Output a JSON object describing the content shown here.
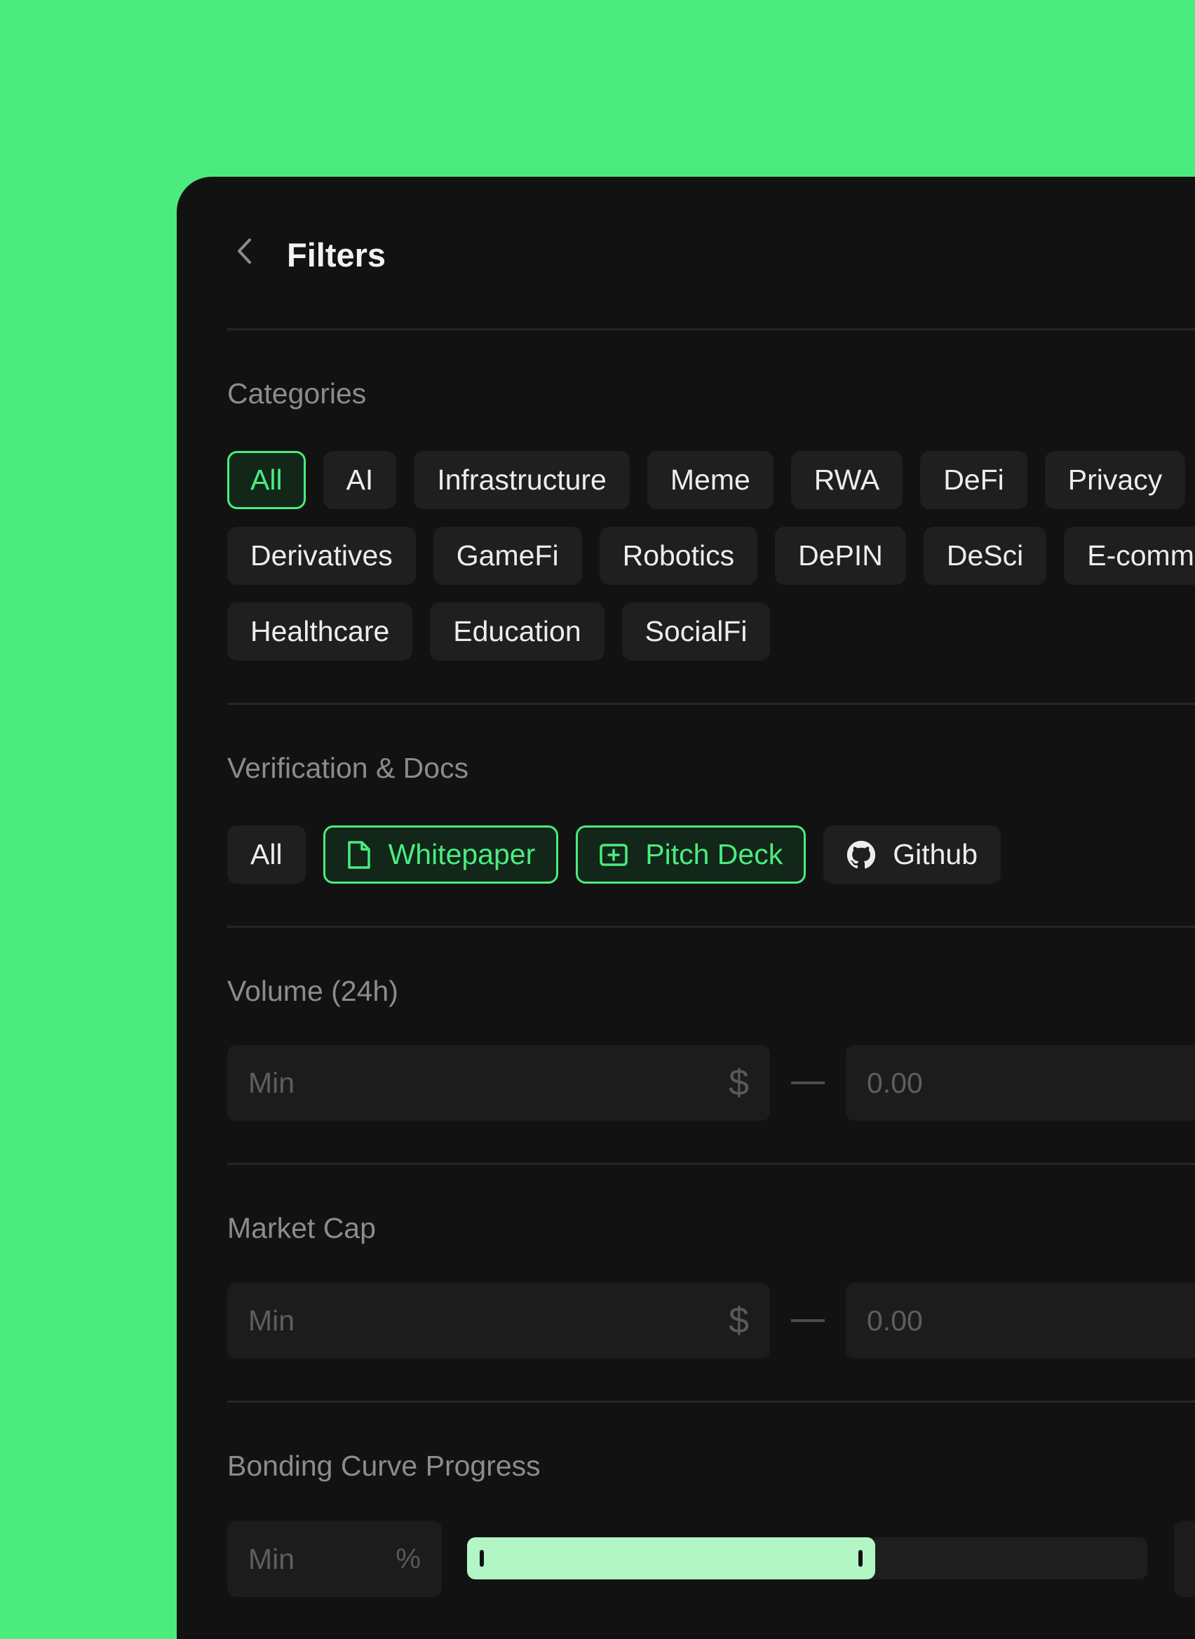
{
  "header": {
    "title": "Filters"
  },
  "categories": {
    "label": "Categories",
    "rows": [
      [
        {
          "label": "All",
          "active": true
        },
        {
          "label": "AI",
          "active": false
        },
        {
          "label": "Infrastructure",
          "active": false
        },
        {
          "label": "Meme",
          "active": false
        },
        {
          "label": "RWA",
          "active": false
        },
        {
          "label": "DeFi",
          "active": false
        },
        {
          "label": "Privacy",
          "active": false
        }
      ],
      [
        {
          "label": "Derivatives",
          "active": false
        },
        {
          "label": "GameFi",
          "active": false
        },
        {
          "label": "Robotics",
          "active": false
        },
        {
          "label": "DePIN",
          "active": false
        },
        {
          "label": "DeSci",
          "active": false
        },
        {
          "label": "E-comm",
          "active": false
        }
      ],
      [
        {
          "label": "Healthcare",
          "active": false
        },
        {
          "label": "Education",
          "active": false
        },
        {
          "label": "SocialFi",
          "active": false
        }
      ]
    ]
  },
  "verification": {
    "label": "Verification & Docs",
    "chips": [
      {
        "label": "All",
        "icon": "",
        "active": false
      },
      {
        "label": "Whitepaper",
        "icon": "document-icon",
        "active": true
      },
      {
        "label": "Pitch Deck",
        "icon": "presentation-icon",
        "active": true
      },
      {
        "label": "Github",
        "icon": "github-icon",
        "active": false
      }
    ]
  },
  "volume": {
    "label": "Volume (24h)",
    "min_placeholder": "Min",
    "min_unit": "$",
    "max_value": "0.00"
  },
  "market_cap": {
    "label": "Market Cap",
    "min_placeholder": "Min",
    "min_unit": "$",
    "max_value": "0.00"
  },
  "bonding_curve": {
    "label": "Bonding Curve Progress",
    "min_placeholder": "Min",
    "min_unit": "%",
    "progress_fraction": 0.6
  },
  "colors": {
    "accent": "#4AEC7E",
    "panel": "#121212",
    "chip": "#1F1F1F",
    "slider_fill": "#B3F6C6"
  }
}
